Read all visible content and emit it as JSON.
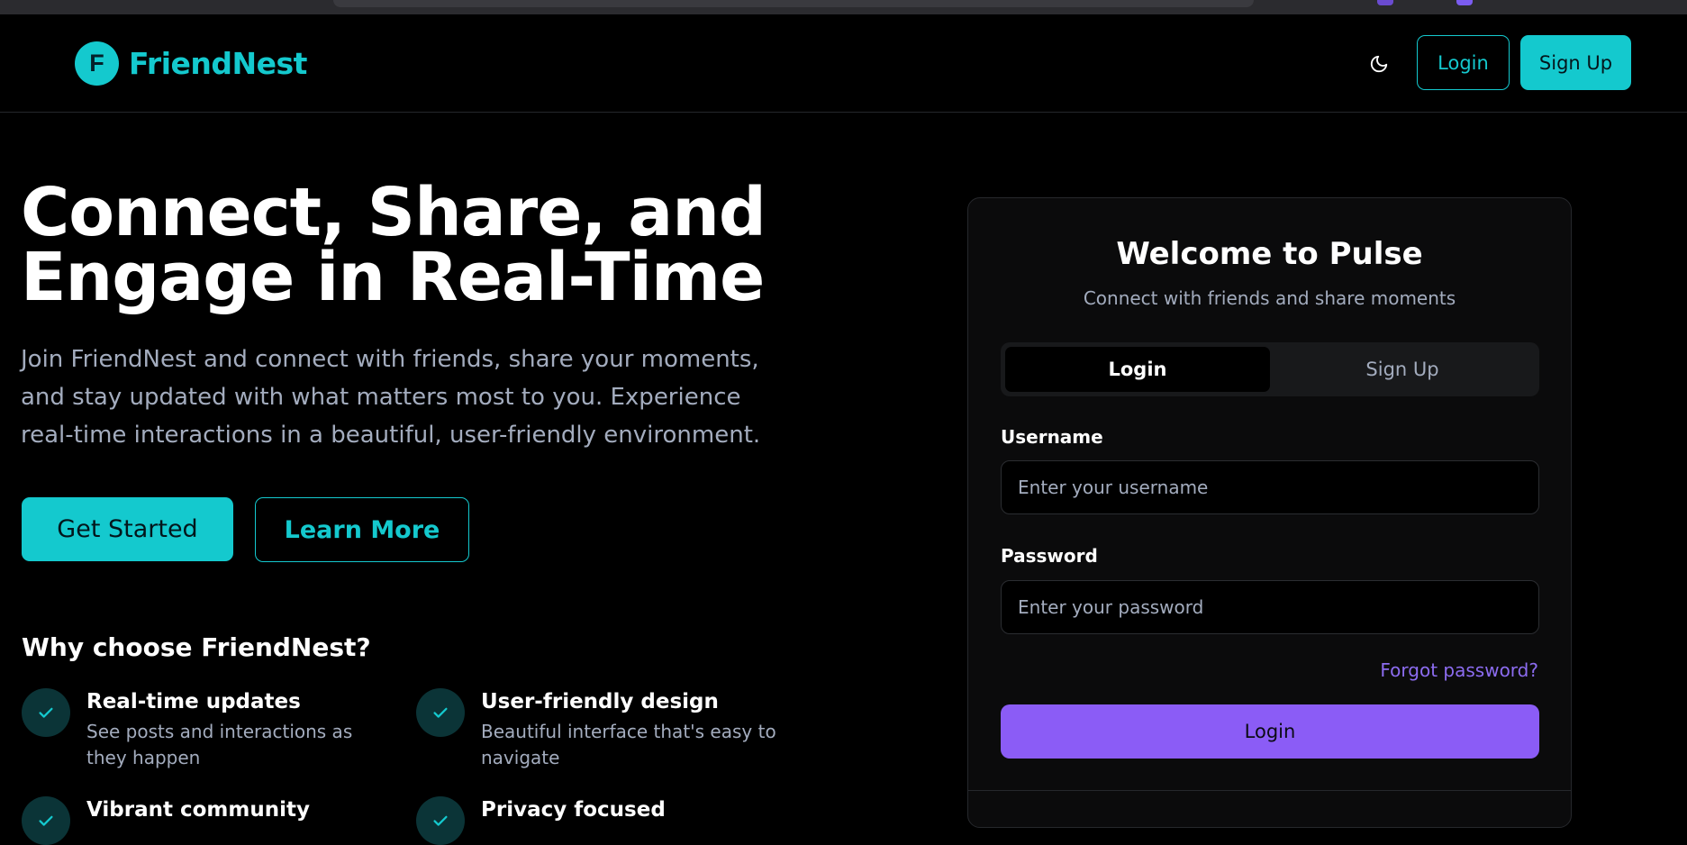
{
  "navbar": {
    "brand_letter": "F",
    "brand_name": "FriendNest",
    "theme_toggle_icon": "moon-icon",
    "login_label": "Login",
    "signup_label": "Sign Up"
  },
  "hero": {
    "title_line1": "Connect, Share, and",
    "title_line2": "Engage in Real-Time",
    "subtitle": "Join FriendNest and connect with friends, share your moments, and stay updated with what matters most to you. Experience real-time interactions in a beautiful, user-friendly environment.",
    "get_started_label": "Get Started",
    "learn_more_label": "Learn More"
  },
  "why": {
    "title": "Why choose FriendNest?",
    "features": [
      {
        "title": "Real-time updates",
        "description": "See posts and interactions as they happen",
        "icon": "check-icon"
      },
      {
        "title": "User-friendly design",
        "description": "Beautiful interface that's easy to navigate",
        "icon": "check-icon"
      },
      {
        "title": "Vibrant community",
        "description": "",
        "icon": "check-icon"
      },
      {
        "title": "Privacy focused",
        "description": "",
        "icon": "check-icon"
      }
    ]
  },
  "auth_card": {
    "title": "Welcome to Pulse",
    "subtitle": "Connect with friends and share moments",
    "tabs": [
      {
        "label": "Login",
        "active": true
      },
      {
        "label": "Sign Up",
        "active": false
      }
    ],
    "username_label": "Username",
    "username_placeholder": "Enter your username",
    "username_value": "",
    "password_label": "Password",
    "password_placeholder": "Enter your password",
    "password_value": "",
    "forgot_label": "Forgot password?",
    "submit_label": "Login"
  },
  "colors": {
    "accent": "#14c9ce",
    "primary_button": "#8b5cf6",
    "background": "#000000",
    "muted_text": "#a3acbe"
  }
}
